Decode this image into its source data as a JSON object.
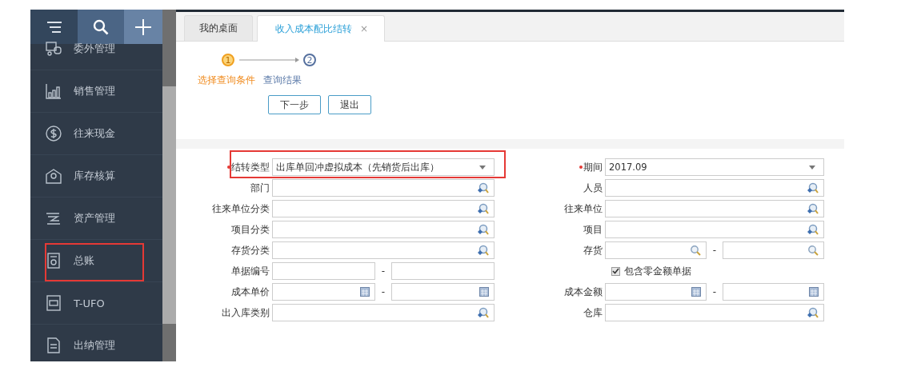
{
  "sidebar": {
    "toolbar": [
      {
        "kind": "menu"
      },
      {
        "kind": "search"
      },
      {
        "kind": "add"
      }
    ],
    "items": [
      {
        "label": "委外管理",
        "highlighted": false
      },
      {
        "label": "销售管理",
        "highlighted": false
      },
      {
        "label": "往来现金",
        "highlighted": false
      },
      {
        "label": "库存核算",
        "highlighted": false
      },
      {
        "label": "资产管理",
        "highlighted": false
      },
      {
        "label": "总账",
        "highlighted": true
      },
      {
        "label": "T-UFO",
        "highlighted": false
      },
      {
        "label": "出纳管理",
        "highlighted": false
      }
    ]
  },
  "tabs": [
    {
      "label": "我的桌面",
      "selected": false
    },
    {
      "label": "收入成本配比结转",
      "selected": true,
      "close": "×"
    }
  ],
  "steps": [
    {
      "number": "1",
      "label": "选择查询条件",
      "selected": true
    },
    {
      "number": "2",
      "label": "查询结果",
      "selected": false
    }
  ],
  "buttons": [
    "下一步",
    "退出"
  ],
  "form": {
    "left": [
      {
        "label": "结转类型",
        "kind": "select",
        "required": true,
        "value": "出库单回冲虚拟成本（先销货后出库）",
        "highlighted": true
      },
      {
        "label": "部门",
        "kind": "lookup"
      },
      {
        "label": "往来单位分类",
        "kind": "lookup"
      },
      {
        "label": "项目分类",
        "kind": "lookup"
      },
      {
        "label": "存货分类",
        "kind": "lookup"
      },
      {
        "label": "单据编号",
        "kind": "range",
        "separator": "-"
      },
      {
        "label": "成本单价",
        "kind": "range-calculator",
        "separator": "-"
      },
      {
        "label": "出入库类别",
        "kind": "lookup"
      }
    ],
    "right": [
      {
        "label": "期间",
        "kind": "select",
        "required": true,
        "value": "2017.09"
      },
      {
        "label": "人员",
        "kind": "lookup"
      },
      {
        "label": "往来单位",
        "kind": "lookup"
      },
      {
        "label": "项目",
        "kind": "lookup"
      },
      {
        "label": "存货",
        "kind": "range-search",
        "separator": "-"
      },
      {
        "label": "包含零金额单据",
        "kind": "checkbox",
        "checked": true
      },
      {
        "label": "成本金额",
        "kind": "range-calculator",
        "separator": "-"
      },
      {
        "label": "仓库",
        "kind": "lookup"
      }
    ]
  }
}
